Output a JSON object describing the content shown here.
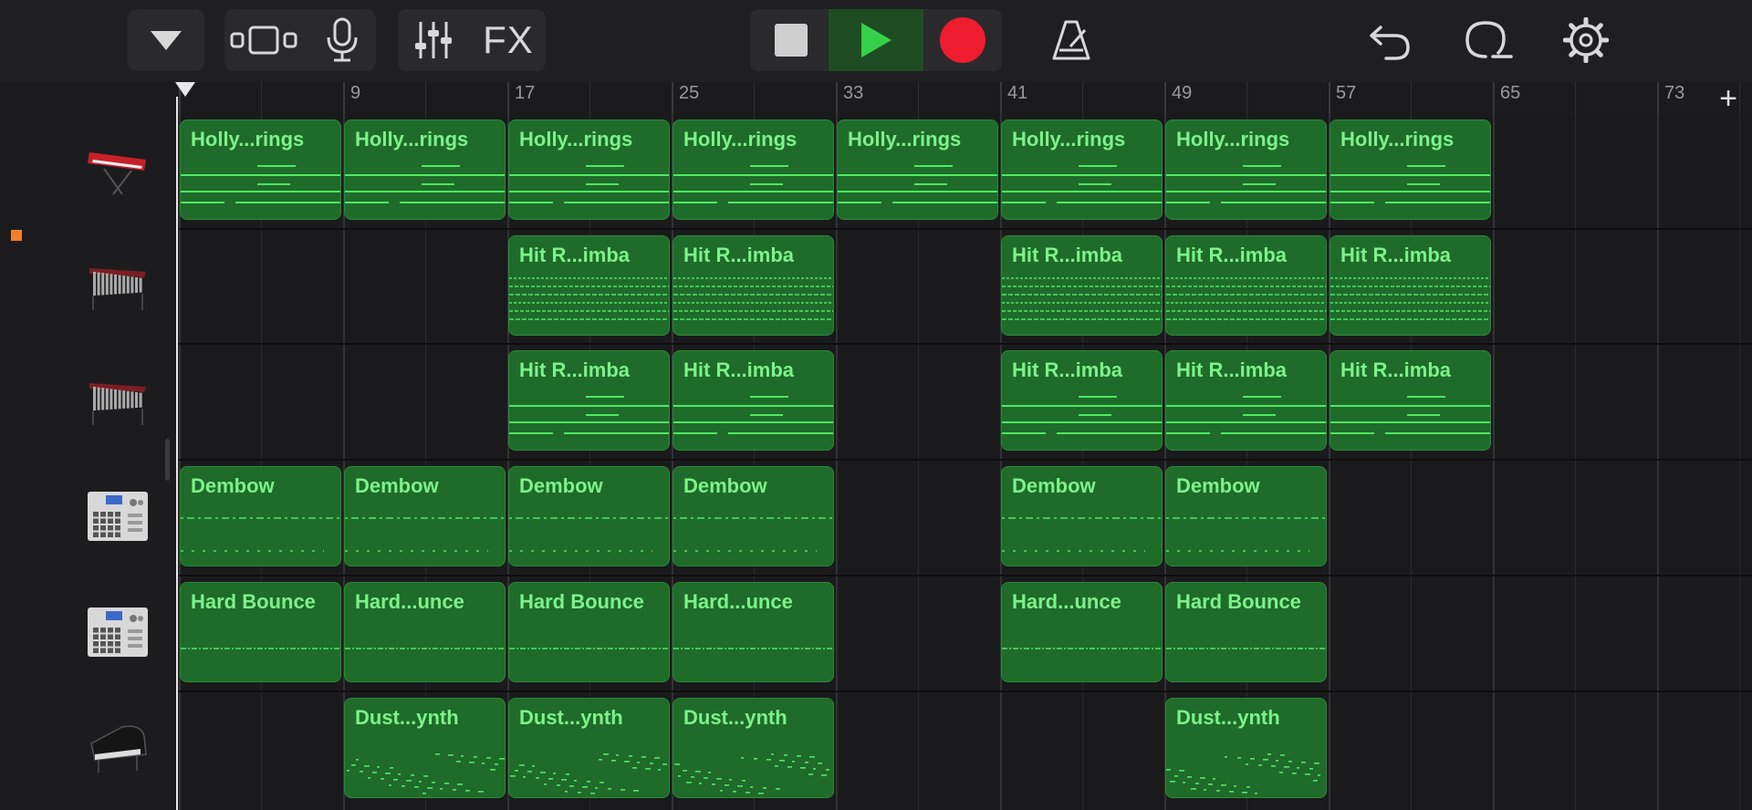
{
  "toolbar": {
    "tracks_dropdown_icon": "triangle-down-icon",
    "view_icon": "tracks-view-icon",
    "mic_icon": "microphone-icon",
    "mixer_icon": "mixer-sliders-icon",
    "fx_label": "FX",
    "stop_icon": "stop-icon",
    "play_icon": "play-icon",
    "record_icon": "record-icon",
    "metronome_icon": "metronome-icon",
    "undo_icon": "undo-icon",
    "loop_icon": "loop-browser-icon",
    "settings_icon": "gear-icon"
  },
  "ruler": {
    "bar_numbers": [
      "9",
      "17",
      "25",
      "33",
      "41",
      "49",
      "57",
      "65",
      "73"
    ],
    "add_button": "+"
  },
  "tracks": [
    {
      "instrument": "keyboard-synth",
      "color": "#c8202a"
    },
    {
      "instrument": "marimba"
    },
    {
      "instrument": "marimba"
    },
    {
      "instrument": "drum-machine"
    },
    {
      "instrument": "drum-machine"
    },
    {
      "instrument": "grand-piano"
    }
  ],
  "regions": [
    {
      "track": 0,
      "bar": 1,
      "name": "Holly...rings",
      "pattern": "lines"
    },
    {
      "track": 0,
      "bar": 9,
      "name": "Holly...rings",
      "pattern": "lines"
    },
    {
      "track": 0,
      "bar": 17,
      "name": "Holly...rings",
      "pattern": "lines"
    },
    {
      "track": 0,
      "bar": 25,
      "name": "Holly...rings",
      "pattern": "lines"
    },
    {
      "track": 0,
      "bar": 33,
      "name": "Holly...rings",
      "pattern": "lines"
    },
    {
      "track": 0,
      "bar": 41,
      "name": "Holly...rings",
      "pattern": "lines"
    },
    {
      "track": 0,
      "bar": 49,
      "name": "Holly...rings",
      "pattern": "lines"
    },
    {
      "track": 0,
      "bar": 57,
      "name": "Holly...rings",
      "pattern": "lines"
    },
    {
      "track": 1,
      "bar": 17,
      "name": "Hit R...imba",
      "pattern": "dashes"
    },
    {
      "track": 1,
      "bar": 25,
      "name": "Hit R...imba",
      "pattern": "dashes"
    },
    {
      "track": 1,
      "bar": 41,
      "name": "Hit R...imba",
      "pattern": "dashes"
    },
    {
      "track": 1,
      "bar": 49,
      "name": "Hit R...imba",
      "pattern": "dashes"
    },
    {
      "track": 1,
      "bar": 57,
      "name": "Hit R...imba",
      "pattern": "dashes"
    },
    {
      "track": 2,
      "bar": 17,
      "name": "Hit R...imba",
      "pattern": "lines"
    },
    {
      "track": 2,
      "bar": 25,
      "name": "Hit R...imba",
      "pattern": "lines"
    },
    {
      "track": 2,
      "bar": 41,
      "name": "Hit R...imba",
      "pattern": "lines"
    },
    {
      "track": 2,
      "bar": 49,
      "name": "Hit R...imba",
      "pattern": "lines"
    },
    {
      "track": 2,
      "bar": 57,
      "name": "Hit R...imba",
      "pattern": "lines"
    },
    {
      "track": 3,
      "bar": 1,
      "name": "Dembow",
      "pattern": "dots"
    },
    {
      "track": 3,
      "bar": 9,
      "name": "Dembow",
      "pattern": "dots"
    },
    {
      "track": 3,
      "bar": 17,
      "name": "Dembow",
      "pattern": "dots"
    },
    {
      "track": 3,
      "bar": 25,
      "name": "Dembow",
      "pattern": "dots"
    },
    {
      "track": 3,
      "bar": 41,
      "name": "Dembow",
      "pattern": "dots"
    },
    {
      "track": 3,
      "bar": 49,
      "name": "Dembow",
      "pattern": "dots"
    },
    {
      "track": 4,
      "bar": 1,
      "name": "Hard Bounce",
      "pattern": "dashline"
    },
    {
      "track": 4,
      "bar": 9,
      "name": "Hard...unce",
      "pattern": "dashline"
    },
    {
      "track": 4,
      "bar": 17,
      "name": "Hard Bounce",
      "pattern": "dashline"
    },
    {
      "track": 4,
      "bar": 25,
      "name": "Hard...unce",
      "pattern": "dashline"
    },
    {
      "track": 4,
      "bar": 41,
      "name": "Hard...unce",
      "pattern": "dashline"
    },
    {
      "track": 4,
      "bar": 49,
      "name": "Hard Bounce",
      "pattern": "dashline"
    },
    {
      "track": 5,
      "bar": 9,
      "name": "Dust...ynth",
      "pattern": "scatter"
    },
    {
      "track": 5,
      "bar": 17,
      "name": "Dust...ynth",
      "pattern": "scatter"
    },
    {
      "track": 5,
      "bar": 25,
      "name": "Dust...ynth",
      "pattern": "scatter"
    },
    {
      "track": 5,
      "bar": 49,
      "name": "Dust...ynth",
      "pattern": "scatter"
    }
  ]
}
